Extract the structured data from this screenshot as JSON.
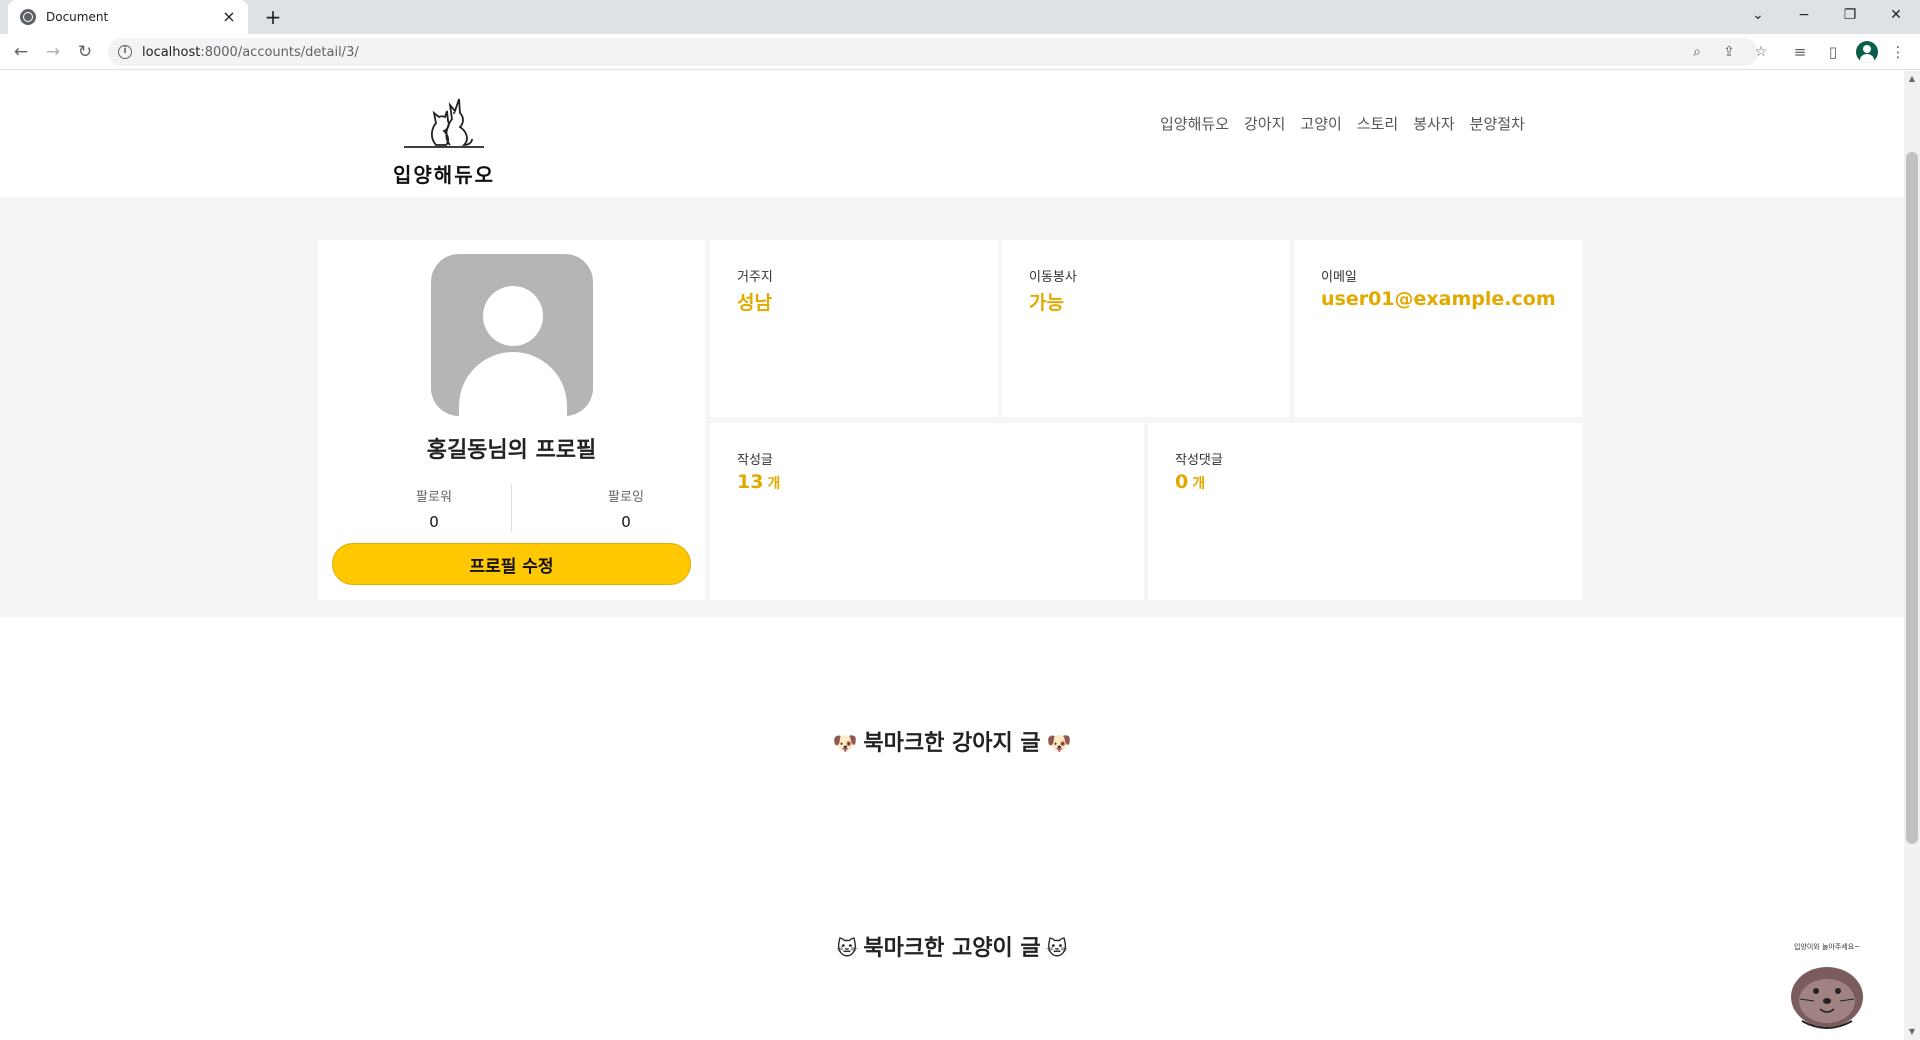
{
  "browser": {
    "tab_title": "Document",
    "tab_close": "×",
    "new_tab": "+",
    "url_host": "localhost",
    "url_path": ":8000/accounts/detail/3/"
  },
  "site": {
    "logo_text": "입양해듀오",
    "nav": [
      "입양해듀오",
      "강아지",
      "고양이",
      "스토리",
      "봉사자",
      "분양절차"
    ]
  },
  "profile": {
    "name": "홍길동님의 프로필",
    "followers_label": "팔로워",
    "followers_count": "0",
    "following_label": "팔로잉",
    "following_count": "0",
    "edit_button": "프로필 수정"
  },
  "stats": {
    "residence_label": "거주지",
    "residence_value": "성남",
    "transport_label": "이동봉사",
    "transport_value": "가능",
    "email_label": "이메일",
    "email_value": "user01@example.com",
    "posts_label": "작성글",
    "posts_count": "13",
    "posts_unit": "개",
    "comments_label": "작성댓글",
    "comments_count": "0",
    "comments_unit": "개"
  },
  "sections": {
    "dog_title": "북마크한 강아지 글",
    "dog_emoji": "🐶",
    "cat_title": "북마크한 고양이 글",
    "cat_emoji": "🐱"
  },
  "chatbot": {
    "caption": "입양이와 놀아주세요~"
  },
  "colors": {
    "accent": "#ffc800",
    "stat_value": "#e2a900",
    "band_bg": "#f5f5f5"
  }
}
